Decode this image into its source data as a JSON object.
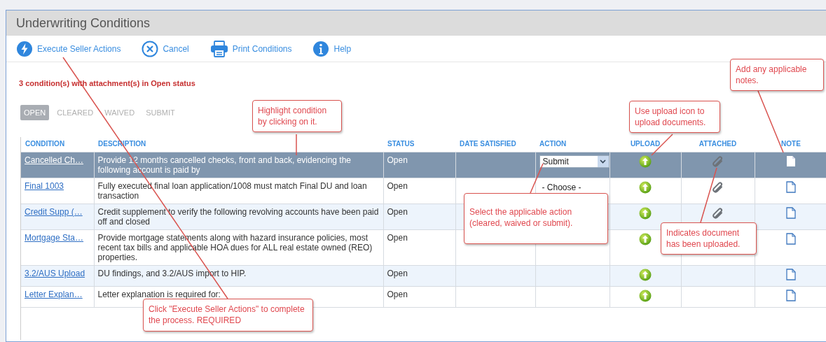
{
  "window": {
    "title": "Underwriting Conditions"
  },
  "toolbar": [
    {
      "kind": "execute",
      "label": "Execute Seller Actions"
    },
    {
      "kind": "cancel",
      "label": "Cancel"
    },
    {
      "kind": "print",
      "label": "Print Conditions"
    },
    {
      "kind": "help",
      "label": "Help"
    }
  ],
  "message": "3 condition(s) with attachment(s) in Open status",
  "tabs": [
    {
      "label": "OPEN",
      "selected": true
    },
    {
      "label": "CLEARED",
      "selected": false
    },
    {
      "label": "WAIVED",
      "selected": false
    },
    {
      "label": "SUBMIT",
      "selected": false
    }
  ],
  "table": {
    "columns": [
      "CONDITION",
      "DESCRIPTION",
      "STATUS",
      "DATE SATISFIED",
      "ACTION",
      "UPLOAD",
      "ATTACHED",
      "NOTE"
    ],
    "rows": [
      {
        "condition": "Cancelled Ch…",
        "description": "Provide 12 months cancelled checks, front and back, evidencing the following account is paid by",
        "status": "Open",
        "action": {
          "value": "Submit",
          "focused": true
        },
        "attached": true,
        "selected": true
      },
      {
        "condition": "Final 1003",
        "description": "Fully executed final loan application/1008 must match Final DU and loan transaction",
        "status": "Open",
        "action": {
          "value": "- Choose -",
          "focused": false
        },
        "attached": true,
        "selected": false
      },
      {
        "condition": "Credit Supp (…",
        "description": "Credit supplement to verify the following revolving accounts have been paid off and closed",
        "status": "Open",
        "attached": true,
        "selected": false
      },
      {
        "condition": "Mortgage Sta…",
        "description": "Provide mortgage statements along with hazard insurance policies, most recent tax bills and applicable HOA dues for ALL real estate owned (REO) properties.",
        "status": "Open",
        "attached": false,
        "selected": false
      },
      {
        "condition": "3.2/AUS Upload",
        "description": "DU findings, and 3.2/AUS import to HIP.",
        "status": "Open",
        "attached": false,
        "selected": false
      },
      {
        "condition": "Letter Explan…",
        "description": "Letter explanation is required for:",
        "status": "Open",
        "attached": false,
        "selected": false
      }
    ]
  },
  "callouts": [
    "Highlight condition by clicking on it.",
    "Use upload icon to upload documents.",
    "Add any applicable notes.",
    "Select the applicable action (cleared, waived or submit).",
    "Indicates document has been uploaded.",
    "Click \"Execute Seller Actions\" to complete the process. REQUIRED"
  ]
}
